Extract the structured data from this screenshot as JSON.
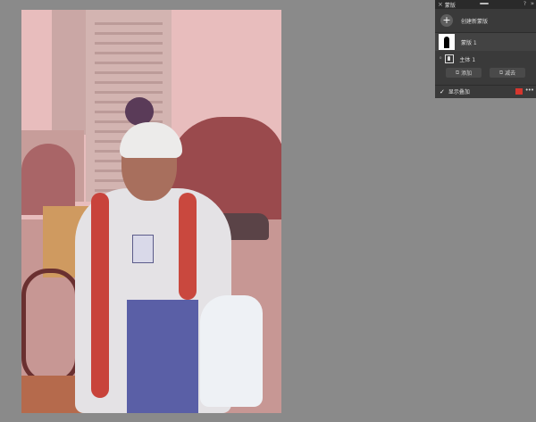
{
  "panel": {
    "close_symbol": "×",
    "title": "蒙版",
    "help_symbol": "?",
    "collapse_symbol": "»",
    "create_button_symbol": "+",
    "create_label": "创建新蒙版",
    "mask_item": {
      "name": "蒙版 1"
    },
    "subject_item": {
      "link_symbol": "⁰",
      "name": "主体 1"
    },
    "add_button": {
      "icon": "⧉",
      "label": "添加"
    },
    "subtract_button": {
      "icon": "⧉",
      "label": "减去"
    },
    "overlay": {
      "check_symbol": "✓",
      "label": "显示叠加",
      "color": "#d6362e",
      "more_symbol": "•••"
    }
  }
}
